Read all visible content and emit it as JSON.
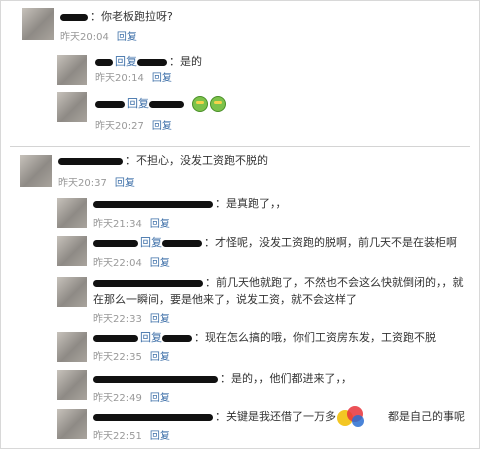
{
  "main_comment": {
    "text": "：你老板跑拉呀?",
    "time": "昨天20:04",
    "reply": "回复"
  },
  "main_replies": [
    {
      "prefix": "回复",
      "text": "：是的",
      "time": "昨天20:14",
      "reply": "回复"
    },
    {
      "prefix": "回复",
      "time": "昨天20:27",
      "reply": "回复"
    }
  ],
  "second_comment": {
    "text": "：不担心，没发工资跑不脱的",
    "time": "昨天20:37",
    "reply": "回复"
  },
  "second_replies": [
    {
      "text": "：是真跑了，，",
      "time": "昨天21:34",
      "reply": "回复"
    },
    {
      "prefix": "回复",
      "text": "：才怪呢，没发工资跑的脱啊，前几天不是在装柜啊",
      "time": "昨天22:04",
      "reply": "回复"
    },
    {
      "text": "：前几天他就跑了，不然也不会这么快就倒闭的，，就",
      "text2": "在那么一瞬间，要是他来了，说发工资，就不会这样了",
      "time": "昨天22:33",
      "reply": "回复"
    },
    {
      "prefix": "回复",
      "text": "：现在怎么搞的哦，你们工资房东发，工资跑不脱",
      "time": "昨天22:35",
      "reply": "回复"
    },
    {
      "text": "：是的，，他们都进来了，，",
      "time": "昨天22:49",
      "reply": "回复"
    },
    {
      "text": "：关键是我还借了一万多",
      "text_tail": "都是自己的事呢",
      "time": "昨天22:51",
      "reply": "回复"
    }
  ],
  "icons": {
    "smiley": "smiley-icon",
    "watermark": "watermark-logo"
  }
}
